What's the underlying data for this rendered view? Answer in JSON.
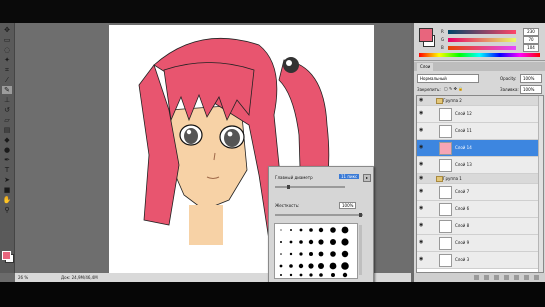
{
  "tools": {
    "icons": [
      "move-icon",
      "marquee-icon",
      "lasso-icon",
      "magic-wand-icon",
      "crop-icon",
      "eyedropper-icon",
      "brush-icon",
      "clone-stamp-icon",
      "history-brush-icon",
      "eraser-icon",
      "gradient-icon",
      "blur-icon",
      "dodge-icon",
      "pen-icon",
      "type-icon",
      "path-select-icon",
      "shape-icon",
      "hand-icon",
      "zoom-icon"
    ],
    "selected": "brush-icon",
    "foreground_color": "#e8657d",
    "background_color": "#ffffff"
  },
  "status": {
    "zoom": "26 %",
    "doc_info": "Док: 24,9М/46,4М"
  },
  "brush_picker": {
    "diameter_label": "Главный диаметр",
    "diameter_value": "11 пикс",
    "hardness_label": "Жесткость:",
    "hardness_value": "100%"
  },
  "color_panel": {
    "r_label": "R",
    "g_label": "G",
    "b_label": "B",
    "r_value": "230",
    "g_value": "70",
    "b_value": "104",
    "color": "#e8657d"
  },
  "layers_panel": {
    "tab_label": "Слои",
    "blend_mode": "Нормальный",
    "opacity_label": "Opacity:",
    "opacity_value": "100%",
    "lock_label": "Закрепить:",
    "fill_label": "Заливка:",
    "fill_value": "100%",
    "layers": [
      {
        "name": "Группа 2",
        "type": "group"
      },
      {
        "name": "Слой 12",
        "type": "layer"
      },
      {
        "name": "Слой 11",
        "type": "layer"
      },
      {
        "name": "Слой 14",
        "type": "layer",
        "active": true
      },
      {
        "name": "Слой 13",
        "type": "layer"
      },
      {
        "name": "Группа 1",
        "type": "group"
      },
      {
        "name": "Слой 7",
        "type": "layer"
      },
      {
        "name": "Слой 6",
        "type": "layer"
      },
      {
        "name": "Слой 8",
        "type": "layer"
      },
      {
        "name": "Слой 9",
        "type": "layer"
      },
      {
        "name": "Слой 3",
        "type": "layer"
      }
    ]
  }
}
